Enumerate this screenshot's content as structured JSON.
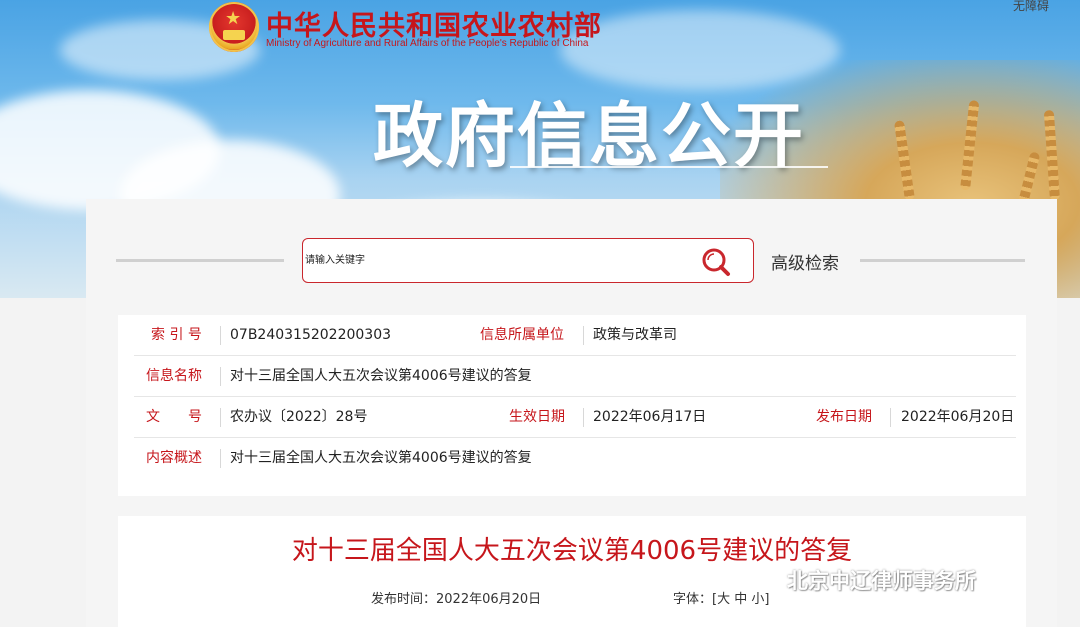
{
  "header": {
    "ministry_cn": "中华人民共和国农业农村部",
    "ministry_en": "Ministry of Agriculture and Rural Affairs of the People's Republic of China",
    "accessibility": "无障碍",
    "hero_title": "政府信息公开"
  },
  "search": {
    "placeholder": "请输入关键字",
    "advanced_label": "高级检索"
  },
  "info": {
    "index_label": "索 引 号",
    "index_value": "07B240315202200303",
    "unit_label": "信息所属单位",
    "unit_value": "政策与改革司",
    "name_label": "信息名称",
    "name_value": "对十三届全国人大五次会议第4006号建议的答复",
    "doc_label": "文　　号",
    "doc_value": "农办议〔2022〕28号",
    "effective_label": "生效日期",
    "effective_value": "2022年06月17日",
    "publish_label": "发布日期",
    "publish_value": "2022年06月20日",
    "summary_label": "内容概述",
    "summary_value": "对十三届全国人大五次会议第4006号建议的答复"
  },
  "article": {
    "title": "对十三届全国人大五次会议第4006号建议的答复",
    "pub_time": "发布时间：2022年06月20日",
    "font_label": "字体：[",
    "font_large": "大",
    "font_medium": "中",
    "font_small": "小",
    "font_close": "]"
  },
  "watermark": {
    "text": "北京中辽律师事务所",
    "icon": "wechat-icon"
  },
  "colors": {
    "brand_red": "#c6161b",
    "search_border": "#c9272d"
  }
}
